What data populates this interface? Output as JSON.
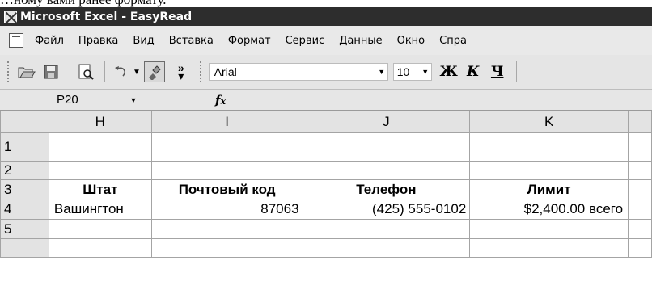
{
  "caption": "…ному вами ранее формату.",
  "window": {
    "title": "Microsoft Excel - EasyRead"
  },
  "menu": {
    "items": [
      {
        "label": "Файл"
      },
      {
        "label": "Правка"
      },
      {
        "label": "Вид"
      },
      {
        "label": "Вставка"
      },
      {
        "label": "Формат"
      },
      {
        "label": "Сервис"
      },
      {
        "label": "Данные"
      },
      {
        "label": "Окно"
      },
      {
        "label": "Спра"
      }
    ]
  },
  "toolbar": {
    "font": "Arial",
    "size": "10",
    "bold": "Ж",
    "italic": "К",
    "underline": "Ч",
    "more": "»"
  },
  "formula_bar": {
    "name_box": "P20",
    "fx": "fx",
    "content": ""
  },
  "grid": {
    "columns": [
      "H",
      "I",
      "J",
      "K"
    ],
    "rows": [
      {
        "num": "1",
        "cells": [
          "",
          "",
          "",
          ""
        ]
      },
      {
        "num": "2",
        "cells": [
          "",
          "",
          "",
          ""
        ]
      },
      {
        "num": "3",
        "cells": [
          "Штат",
          "Почтовый код",
          "Телефон",
          "Лимит"
        ]
      },
      {
        "num": "4",
        "cells": [
          "Вашингтон",
          "87063",
          "(425) 555-0102",
          "$2,400.00 всего"
        ]
      },
      {
        "num": "5",
        "cells": [
          "",
          "",
          "",
          ""
        ]
      },
      {
        "num": "",
        "cells": [
          "",
          "",
          "",
          ""
        ]
      }
    ]
  }
}
